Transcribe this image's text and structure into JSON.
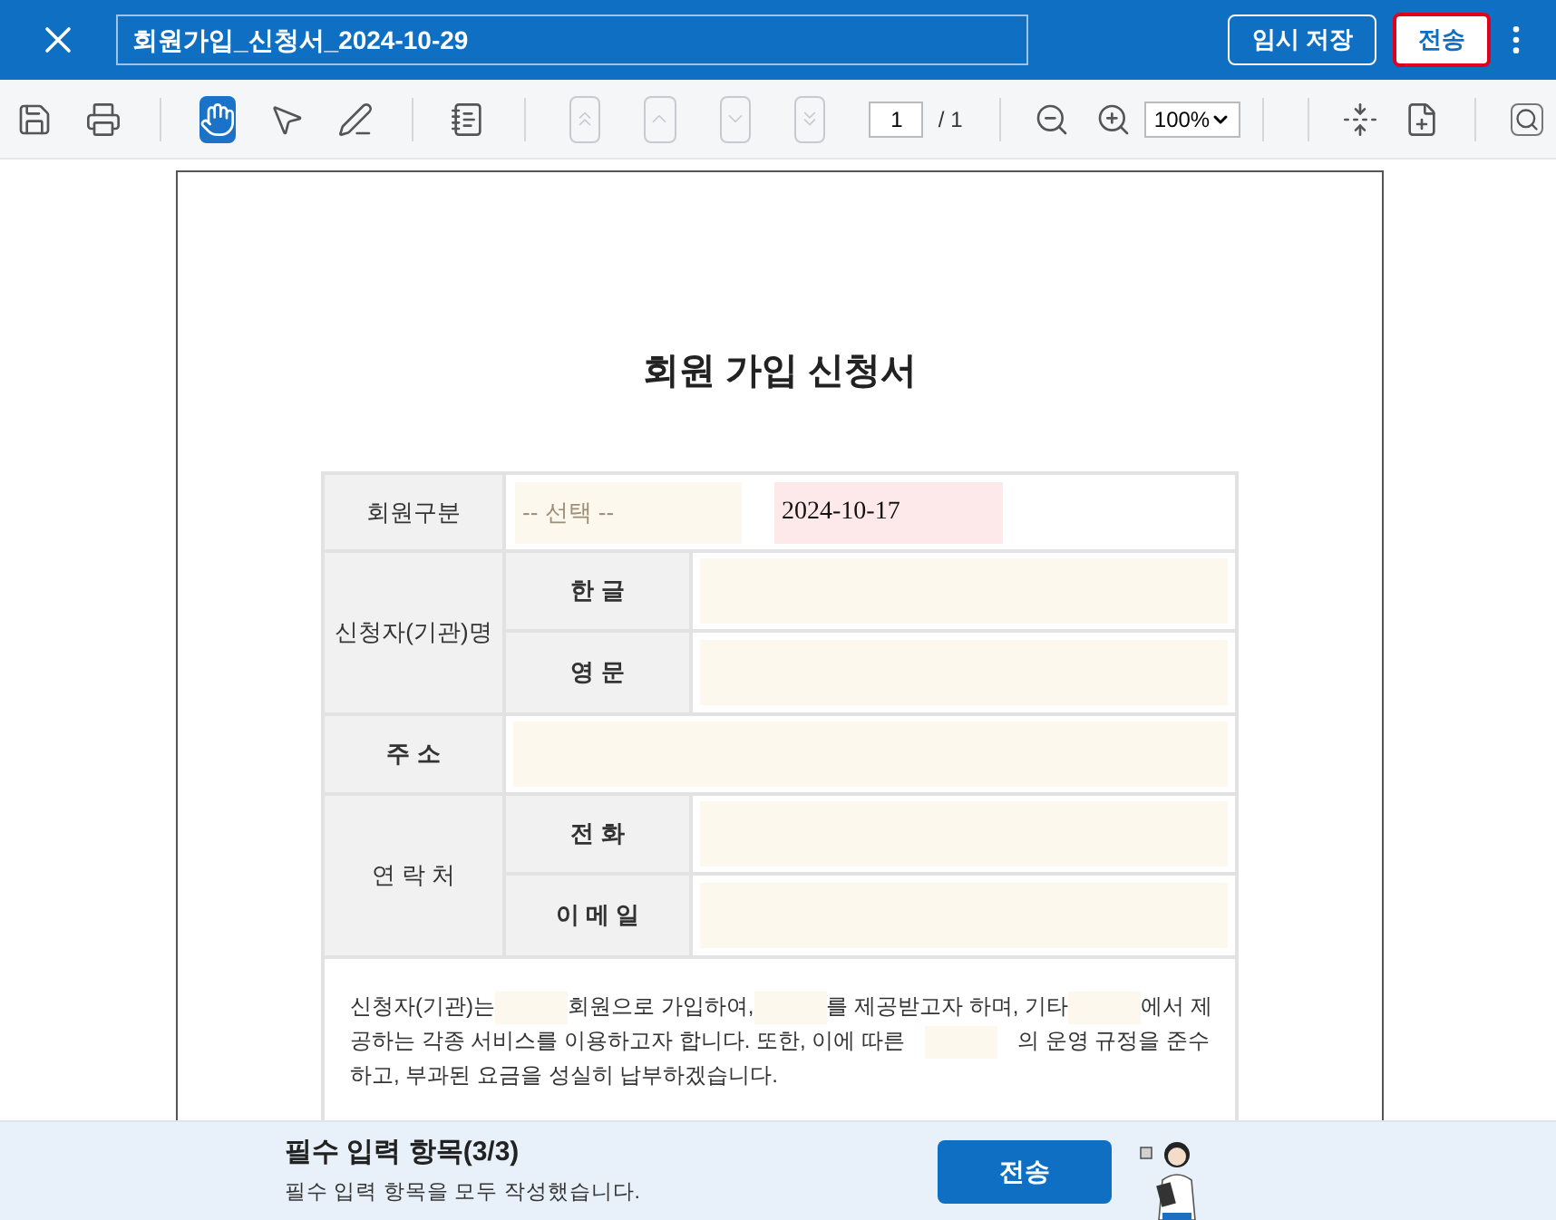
{
  "header": {
    "title": "회원가입_신청서_2024-10-29",
    "buttons": [
      {
        "label": "임시 저장",
        "highlighted": false
      },
      {
        "label": "전송",
        "highlighted": true
      }
    ]
  },
  "toolbar": {
    "tools": [
      {
        "kind": "save",
        "selected": false,
        "disabled": false
      },
      {
        "kind": "print",
        "selected": false,
        "disabled": false
      },
      {
        "kind": "sep"
      },
      {
        "kind": "hand",
        "selected": true,
        "disabled": false
      },
      {
        "kind": "pointer",
        "selected": false,
        "disabled": false
      },
      {
        "kind": "pencil",
        "selected": false,
        "disabled": false
      },
      {
        "kind": "sep"
      },
      {
        "kind": "notes",
        "selected": false,
        "disabled": false
      },
      {
        "kind": "sep"
      },
      {
        "kind": "first",
        "disabled": true
      },
      {
        "kind": "prev",
        "disabled": true
      },
      {
        "kind": "next",
        "disabled": true
      },
      {
        "kind": "last",
        "disabled": true
      }
    ],
    "page": "1",
    "page_total": "/ 1",
    "zoom": "100%"
  },
  "document": {
    "title": "회원 가입 신청서",
    "rows": [
      {
        "kind": "select",
        "label": "회원구분",
        "placeholder": "-- 선택 --",
        "date": "2024-10-17"
      },
      {
        "kind": "group",
        "label": "신청자(기관)명",
        "fields": [
          "한 글",
          "영 문"
        ]
      },
      {
        "kind": "single",
        "label": "주 소"
      },
      {
        "kind": "group",
        "label": "연 락 처",
        "fields": [
          "전 화",
          "이 메 일"
        ]
      }
    ],
    "paragraph": [
      [
        {
          "kind": "text",
          "text": "신청자(기관)는"
        },
        {
          "kind": "blank"
        },
        {
          "kind": "text",
          "text": "회원으로 가입하여,"
        },
        {
          "kind": "blank"
        },
        {
          "kind": "text",
          "text": "를 제공받고자 하며, 기타"
        },
        {
          "kind": "blank"
        },
        {
          "kind": "text",
          "text": "에서 제"
        }
      ],
      [
        {
          "kind": "text",
          "text": "공하는 각종 서비스를 이용하고자 합니다. 또한, 이에 따른"
        },
        {
          "kind": "blank"
        },
        {
          "kind": "text",
          "text": "의 운영 규정을 준수"
        }
      ],
      [
        {
          "kind": "text",
          "text": "하고, 부과된 요금을 성실히 납부하겠습니다."
        }
      ]
    ]
  },
  "footer": {
    "title": "필수 입력 항목(3/3)",
    "message": "필수 입력 항목을 모두 작성했습니다.",
    "button": "전송"
  }
}
